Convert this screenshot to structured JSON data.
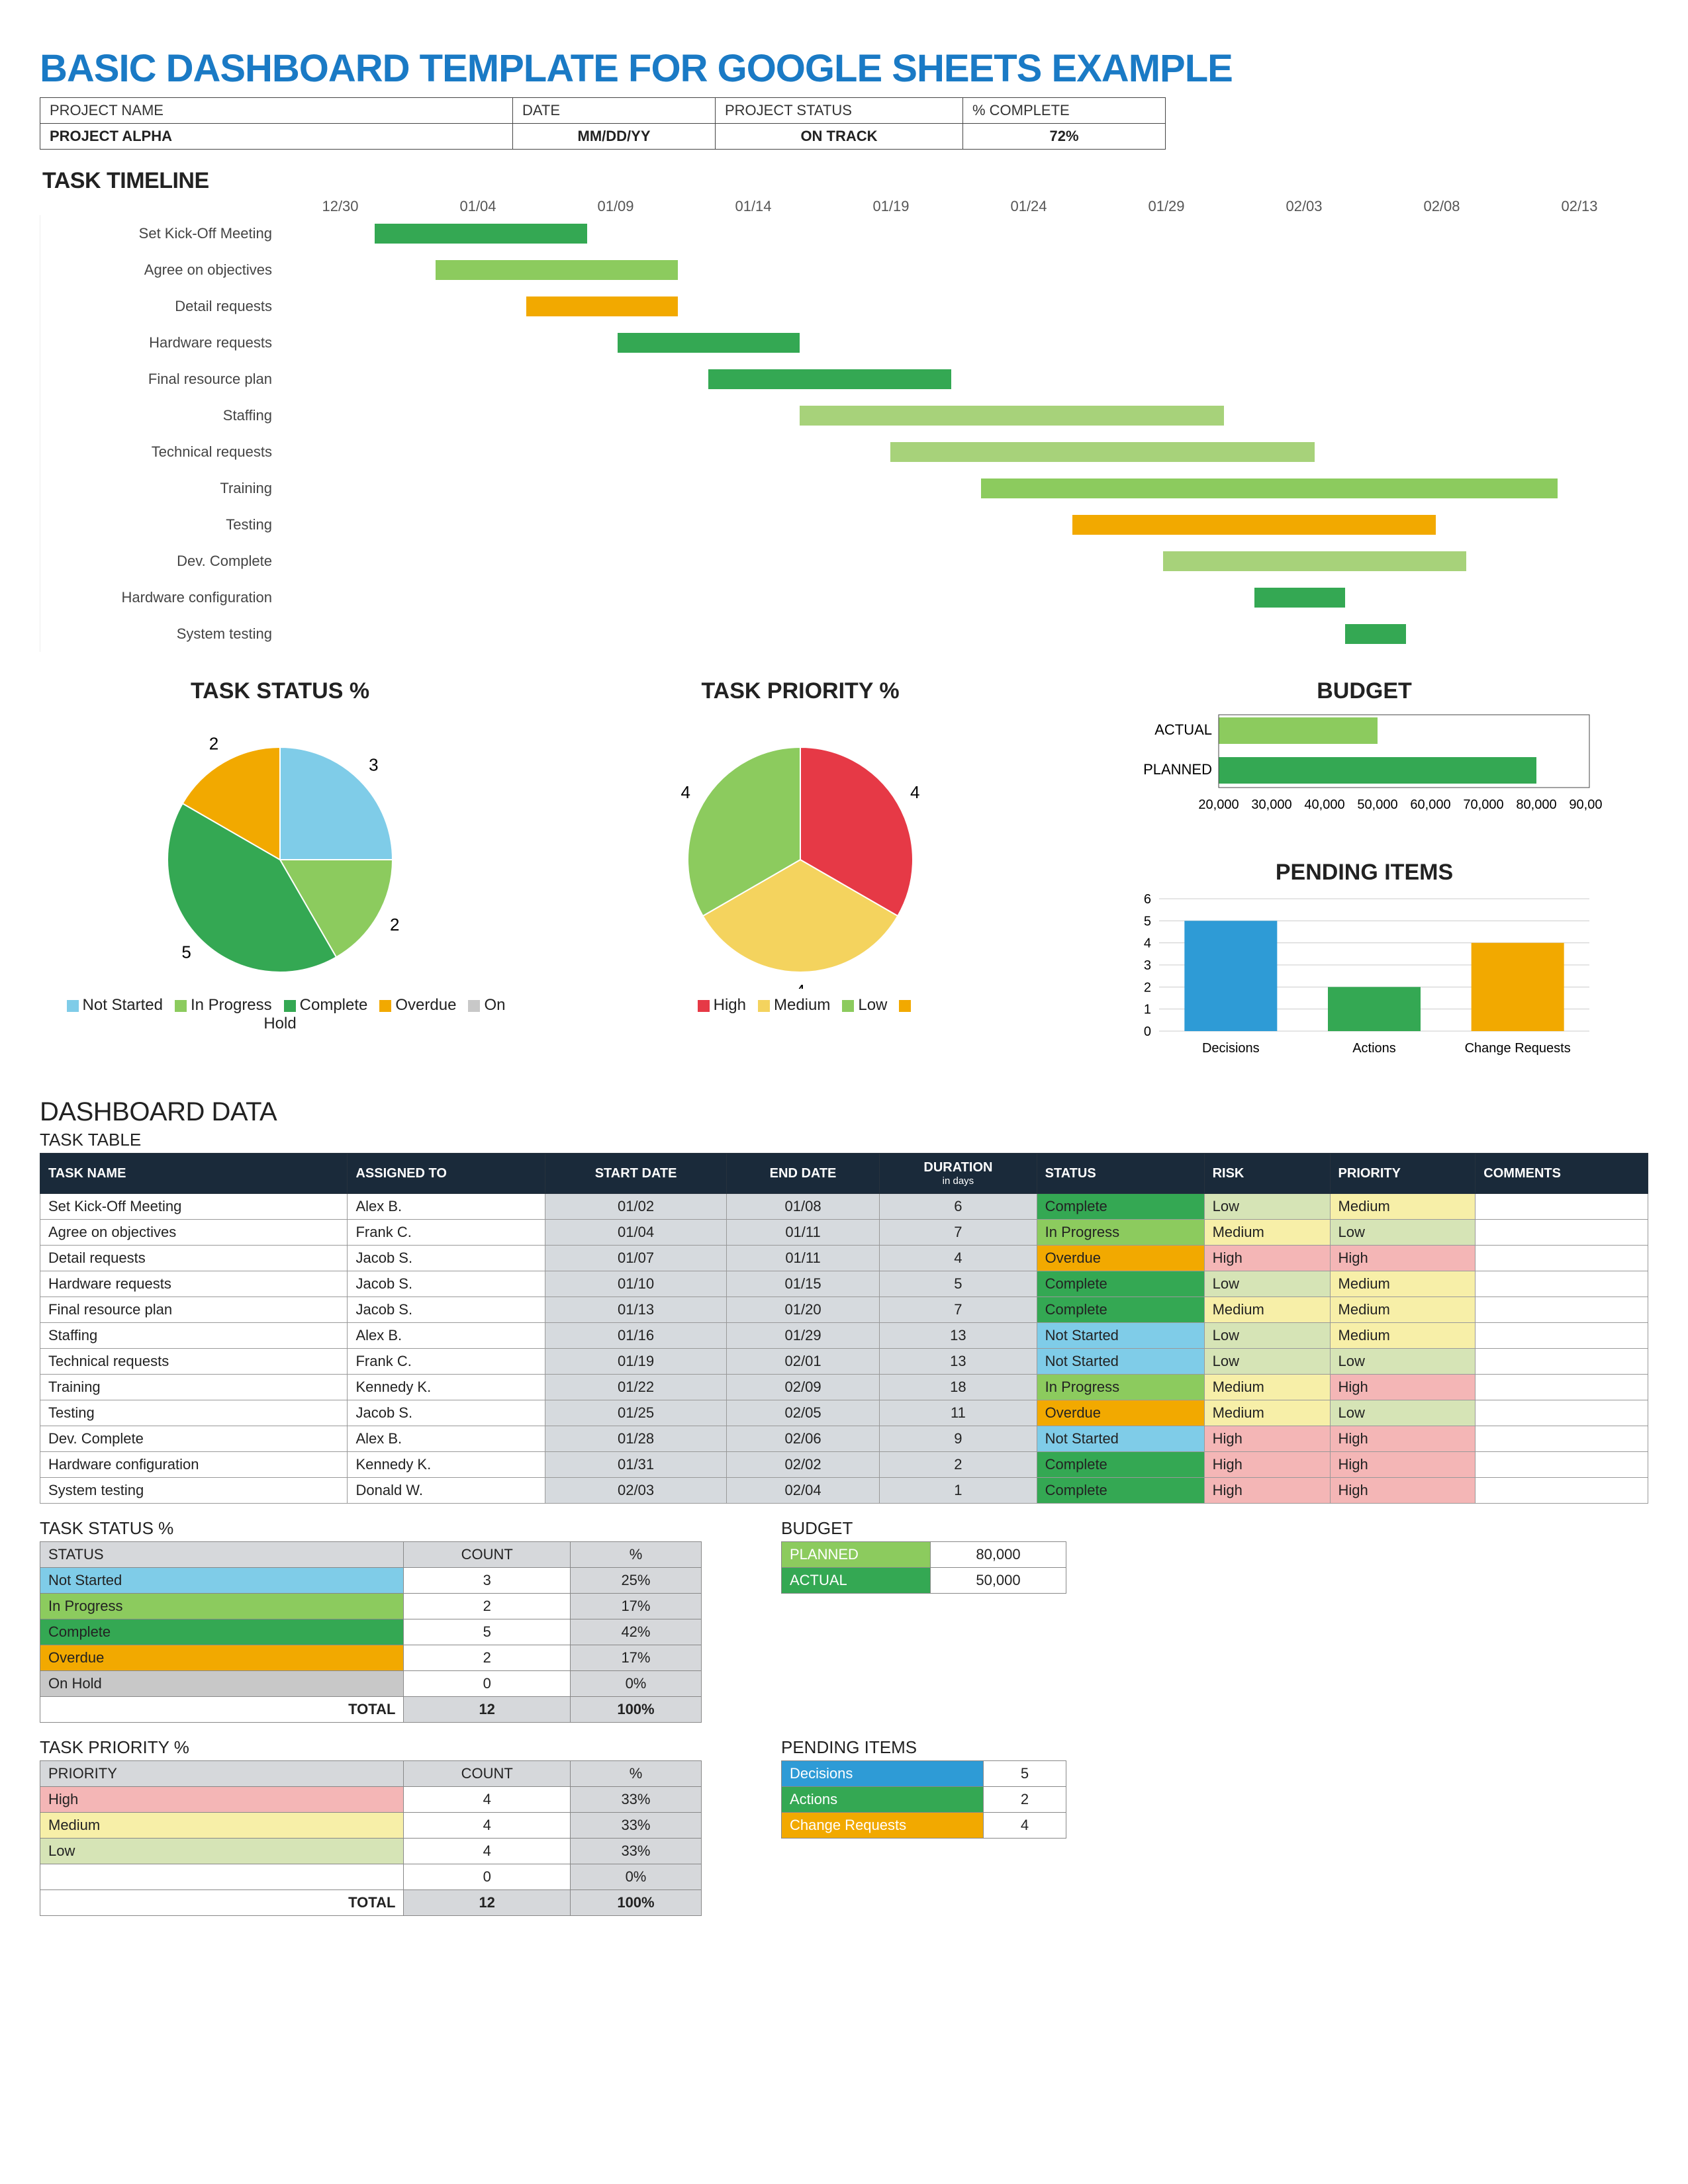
{
  "title": "BASIC DASHBOARD TEMPLATE FOR GOOGLE SHEETS EXAMPLE",
  "header": {
    "labels": {
      "projectName": "PROJECT NAME",
      "date": "DATE",
      "status": "PROJECT STATUS",
      "pct": "% COMPLETE"
    },
    "projectName": "PROJECT ALPHA",
    "date": "MM/DD/YY",
    "status": "ON TRACK",
    "pct": "72%"
  },
  "timeline": {
    "title": "TASK TIMELINE",
    "axis": [
      "12/30",
      "01/04",
      "01/09",
      "01/14",
      "01/19",
      "01/24",
      "01/29",
      "02/03",
      "02/08",
      "02/13"
    ],
    "start": "2021-12-30",
    "end": "2022-02-13",
    "tasks": [
      {
        "name": "Set Kick-Off Meeting",
        "start": "01/02",
        "end": "01/08",
        "status": "Complete"
      },
      {
        "name": "Agree on objectives",
        "start": "01/04",
        "end": "01/11",
        "status": "InProgress"
      },
      {
        "name": "Detail requests",
        "start": "01/07",
        "end": "01/11",
        "status": "Overdue"
      },
      {
        "name": "Hardware requests",
        "start": "01/10",
        "end": "01/15",
        "status": "Complete"
      },
      {
        "name": "Final resource plan",
        "start": "01/13",
        "end": "01/20",
        "status": "Complete"
      },
      {
        "name": "Staffing",
        "start": "01/16",
        "end": "01/29",
        "status": "NotStarted"
      },
      {
        "name": "Technical requests",
        "start": "01/19",
        "end": "02/01",
        "status": "NotStarted"
      },
      {
        "name": "Training",
        "start": "01/22",
        "end": "02/09",
        "status": "InProgress"
      },
      {
        "name": "Testing",
        "start": "01/25",
        "end": "02/05",
        "status": "Overdue"
      },
      {
        "name": "Dev. Complete",
        "start": "01/28",
        "end": "02/06",
        "status": "NotStarted"
      },
      {
        "name": "Hardware configuration",
        "start": "01/31",
        "end": "02/02",
        "status": "Complete"
      },
      {
        "name": "System testing",
        "start": "02/03",
        "end": "02/04",
        "status": "Complete"
      }
    ],
    "colors": {
      "Complete": "#34A853",
      "InProgress": "#8CCB5E",
      "Overdue": "#F2A900",
      "NotStarted": "#A7D27A",
      "OnHold": "#C8C8C8"
    }
  },
  "chart_data": [
    {
      "id": "task_status",
      "type": "pie",
      "title": "TASK STATUS %",
      "series": [
        {
          "name": "Not Started",
          "value": 3,
          "color": "#7FCCE8"
        },
        {
          "name": "In Progress",
          "value": 2,
          "color": "#8CCB5E"
        },
        {
          "name": "Complete",
          "value": 5,
          "color": "#34A853"
        },
        {
          "name": "Overdue",
          "value": 2,
          "color": "#F2A900"
        },
        {
          "name": "On Hold",
          "value": 0,
          "color": "#C8C8C8"
        }
      ]
    },
    {
      "id": "task_priority",
      "type": "pie",
      "title": "TASK PRIORITY %",
      "series": [
        {
          "name": "High",
          "value": 4,
          "color": "#E63946"
        },
        {
          "name": "Medium",
          "value": 4,
          "color": "#F4D35E"
        },
        {
          "name": "Low",
          "value": 4,
          "color": "#8CCB5E"
        },
        {
          "name": "",
          "value": 0,
          "color": "#F2A900"
        }
      ]
    },
    {
      "id": "budget",
      "type": "bar",
      "orientation": "horizontal",
      "title": "BUDGET",
      "categories": [
        "ACTUAL",
        "PLANNED"
      ],
      "values": [
        50000,
        80000
      ],
      "colors": [
        "#8CCB5E",
        "#34A853"
      ],
      "xlim": [
        20000,
        90000
      ],
      "xTicks": [
        20000,
        30000,
        40000,
        50000,
        60000,
        70000,
        80000,
        90000
      ]
    },
    {
      "id": "pending",
      "type": "bar",
      "title": "PENDING ITEMS",
      "categories": [
        "Decisions",
        "Actions",
        "Change Requests"
      ],
      "values": [
        5,
        2,
        4
      ],
      "colors": [
        "#2E9BD6",
        "#34A853",
        "#F2A900"
      ],
      "ylim": [
        0,
        6
      ],
      "yTicks": [
        0,
        1,
        2,
        3,
        4,
        5,
        6
      ]
    }
  ],
  "dashHeader": "DASHBOARD DATA",
  "taskTable": {
    "title": "TASK TABLE",
    "columns": [
      "TASK NAME",
      "ASSIGNED TO",
      "START DATE",
      "END DATE",
      "DURATION  in days",
      "STATUS",
      "RISK",
      "PRIORITY",
      "COMMENTS"
    ],
    "rows": [
      {
        "name": "Set Kick-Off Meeting",
        "assigned": "Alex B.",
        "start": "01/02",
        "end": "01/08",
        "dur": "6",
        "status": "Complete",
        "risk": "Low",
        "priority": "Medium",
        "comments": ""
      },
      {
        "name": "Agree on objectives",
        "assigned": "Frank C.",
        "start": "01/04",
        "end": "01/11",
        "dur": "7",
        "status": "In Progress",
        "risk": "Medium",
        "priority": "Low",
        "comments": ""
      },
      {
        "name": "Detail requests",
        "assigned": "Jacob S.",
        "start": "01/07",
        "end": "01/11",
        "dur": "4",
        "status": "Overdue",
        "risk": "High",
        "priority": "High",
        "comments": ""
      },
      {
        "name": "Hardware requests",
        "assigned": "Jacob S.",
        "start": "01/10",
        "end": "01/15",
        "dur": "5",
        "status": "Complete",
        "risk": "Low",
        "priority": "Medium",
        "comments": ""
      },
      {
        "name": "Final resource plan",
        "assigned": "Jacob S.",
        "start": "01/13",
        "end": "01/20",
        "dur": "7",
        "status": "Complete",
        "risk": "Medium",
        "priority": "Medium",
        "comments": ""
      },
      {
        "name": "Staffing",
        "assigned": "Alex B.",
        "start": "01/16",
        "end": "01/29",
        "dur": "13",
        "status": "Not Started",
        "risk": "Low",
        "priority": "Medium",
        "comments": ""
      },
      {
        "name": "Technical requests",
        "assigned": "Frank C.",
        "start": "01/19",
        "end": "02/01",
        "dur": "13",
        "status": "Not Started",
        "risk": "Low",
        "priority": "Low",
        "comments": ""
      },
      {
        "name": "Training",
        "assigned": "Kennedy K.",
        "start": "01/22",
        "end": "02/09",
        "dur": "18",
        "status": "In Progress",
        "risk": "Medium",
        "priority": "High",
        "comments": ""
      },
      {
        "name": "Testing",
        "assigned": "Jacob S.",
        "start": "01/25",
        "end": "02/05",
        "dur": "11",
        "status": "Overdue",
        "risk": "Medium",
        "priority": "Low",
        "comments": ""
      },
      {
        "name": "Dev. Complete",
        "assigned": "Alex B.",
        "start": "01/28",
        "end": "02/06",
        "dur": "9",
        "status": "Not Started",
        "risk": "High",
        "priority": "High",
        "comments": ""
      },
      {
        "name": "Hardware configuration",
        "assigned": "Kennedy K.",
        "start": "01/31",
        "end": "02/02",
        "dur": "2",
        "status": "Complete",
        "risk": "High",
        "priority": "High",
        "comments": ""
      },
      {
        "name": "System testing",
        "assigned": "Donald W.",
        "start": "02/03",
        "end": "02/04",
        "dur": "1",
        "status": "Complete",
        "risk": "High",
        "priority": "High",
        "comments": ""
      }
    ]
  },
  "statusTable": {
    "title": "TASK STATUS %",
    "columns": [
      "STATUS",
      "COUNT",
      "%"
    ],
    "rows": [
      {
        "k": "Not Started",
        "key": "NotStarted",
        "count": 3,
        "pct": "25%"
      },
      {
        "k": "In Progress",
        "key": "InProgress",
        "count": 2,
        "pct": "17%"
      },
      {
        "k": "Complete",
        "key": "Complete",
        "count": 5,
        "pct": "42%"
      },
      {
        "k": "Overdue",
        "key": "Overdue",
        "count": 2,
        "pct": "17%"
      },
      {
        "k": "On Hold",
        "key": "OnHold",
        "count": 0,
        "pct": "0%"
      }
    ],
    "total": {
      "label": "TOTAL",
      "count": 12,
      "pct": "100%"
    }
  },
  "budgetTable": {
    "title": "BUDGET",
    "rows": [
      {
        "k": "PLANNED",
        "key": "Planned",
        "val": "80,000"
      },
      {
        "k": "ACTUAL",
        "key": "Actual",
        "val": "50,000"
      }
    ]
  },
  "priorityTable": {
    "title": "TASK PRIORITY %",
    "columns": [
      "PRIORITY",
      "COUNT",
      "%"
    ],
    "rows": [
      {
        "k": "High",
        "key": "High",
        "count": 4,
        "pct": "33%"
      },
      {
        "k": "Medium",
        "key": "Medium",
        "count": 4,
        "pct": "33%"
      },
      {
        "k": "Low",
        "key": "Low",
        "count": 4,
        "pct": "33%"
      },
      {
        "k": "",
        "key": "",
        "count": 0,
        "pct": "0%"
      }
    ],
    "total": {
      "label": "TOTAL",
      "count": 12,
      "pct": "100%"
    }
  },
  "pendingTable": {
    "title": "PENDING ITEMS",
    "rows": [
      {
        "k": "Decisions",
        "key": "Decisions",
        "val": 5
      },
      {
        "k": "Actions",
        "key": "Actions",
        "val": 2
      },
      {
        "k": "Change Requests",
        "key": "ChangeRequests",
        "val": 4
      }
    ]
  }
}
